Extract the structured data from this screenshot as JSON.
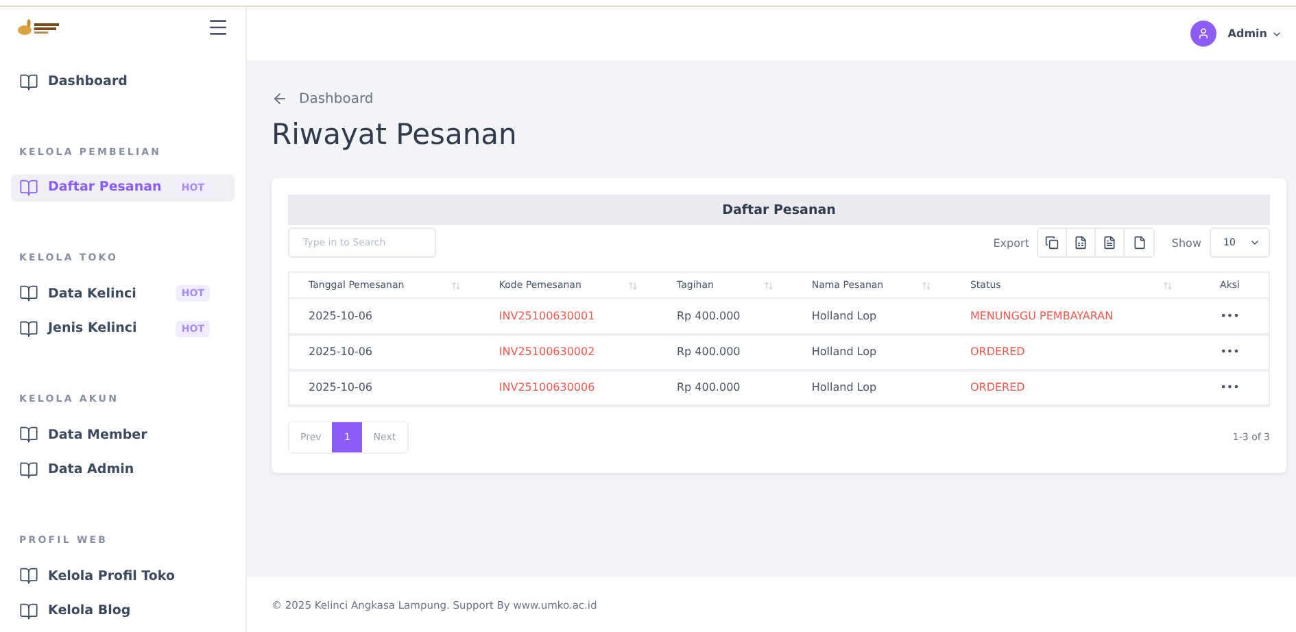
{
  "header": {
    "user": "Admin"
  },
  "sidebar": [
    {
      "kind": "item",
      "label": "Dashboard",
      "selected": false
    },
    {
      "kind": "section",
      "label": "KELOLA PEMBELIAN"
    },
    {
      "kind": "item",
      "label": "Daftar Pesanan",
      "badge": "HOT",
      "selected": true
    },
    {
      "kind": "section",
      "label": "KELOLA TOKO"
    },
    {
      "kind": "item",
      "label": "Data Kelinci",
      "badge": "HOT",
      "selected": false
    },
    {
      "kind": "item",
      "label": "Jenis Kelinci",
      "badge": "HOT",
      "selected": false
    },
    {
      "kind": "section",
      "label": "KELOLA AKUN"
    },
    {
      "kind": "item",
      "label": "Data Member",
      "selected": false
    },
    {
      "kind": "item",
      "label": "Data Admin",
      "selected": false
    },
    {
      "kind": "section",
      "label": "PROFIL WEB"
    },
    {
      "kind": "item",
      "label": "Kelola Profil Toko",
      "selected": false
    },
    {
      "kind": "item",
      "label": "Kelola Blog",
      "selected": false
    }
  ],
  "breadcrumb": "Dashboard",
  "title": "Riwayat Pesanan",
  "card": {
    "title": "Daftar Pesanan",
    "search": {
      "placeholder": "Type in to Search"
    },
    "export_label": "Export",
    "show_label": "Show",
    "show_value": "10",
    "columns": [
      {
        "label": "Tanggal Pemesanan",
        "sortable": true
      },
      {
        "label": "Kode Pemesanan",
        "sortable": true
      },
      {
        "label": "Tagihan",
        "sortable": true
      },
      {
        "label": "Nama Pesanan",
        "sortable": true
      },
      {
        "label": "Status",
        "sortable": true
      },
      {
        "label": "Aksi",
        "sortable": false
      }
    ],
    "rows": [
      {
        "date": "2025-10-06",
        "code": "INV25100630001",
        "amount": "Rp 400.000",
        "name": "Holland Lop",
        "status": "MENUNGGU PEMBAYARAN",
        "action": "•••"
      },
      {
        "date": "2025-10-06",
        "code": "INV25100630002",
        "amount": "Rp 400.000",
        "name": "Holland Lop",
        "status": "ORDERED",
        "action": "•••"
      },
      {
        "date": "2025-10-06",
        "code": "INV25100630006",
        "amount": "Rp 400.000",
        "name": "Holland Lop",
        "status": "ORDERED",
        "action": "•••"
      }
    ],
    "pagination": {
      "prev": {
        "label": "Prev",
        "disabled": true
      },
      "pages": [
        {
          "label": "1",
          "selected": true
        }
      ],
      "next": {
        "label": "Next",
        "disabled": true
      }
    },
    "range": "1-3 of 3"
  },
  "footer": "© 2025 Kelinci Angkasa Lampung. Support By www.umko.ac.id"
}
